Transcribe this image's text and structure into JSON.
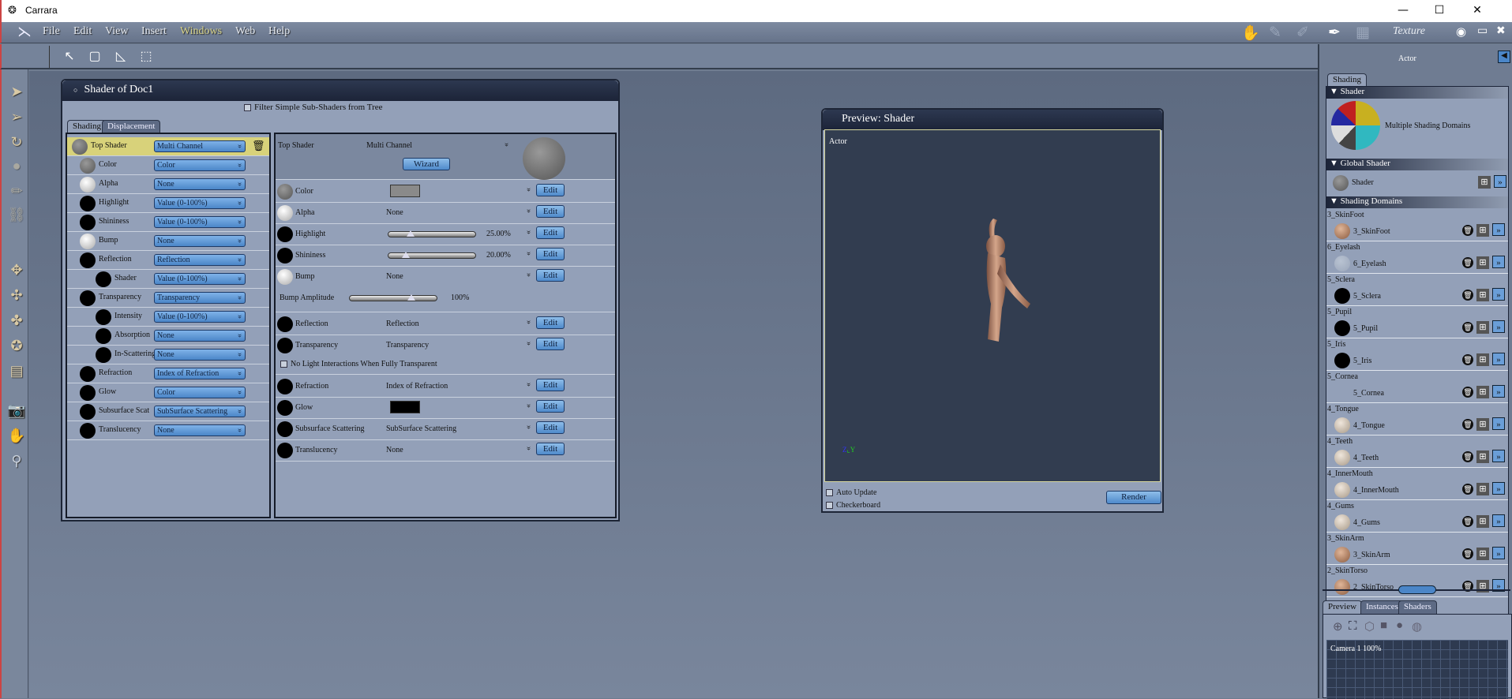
{
  "app": {
    "title": "Carrara",
    "minimize": "—",
    "maximize": "☐",
    "close": "✕"
  },
  "menu": [
    "File",
    "Edit",
    "View",
    "Insert",
    "Windows",
    "Web",
    "Help"
  ],
  "room": {
    "label": "Texture"
  },
  "shader_panel": {
    "title": "Shader of Doc1",
    "filter_label": "Filter Simple Sub-Shaders from Tree",
    "tabs": [
      "Shading",
      "Displacement"
    ],
    "tree": [
      {
        "label": "Top Shader",
        "value": "Multi Channel",
        "ball": "grey",
        "level": 0,
        "selected": true
      },
      {
        "label": "Color",
        "value": "Color",
        "ball": "grey",
        "level": 1
      },
      {
        "label": "Alpha",
        "value": "None",
        "ball": "white",
        "level": 1
      },
      {
        "label": "Highlight",
        "value": "Value (0-100%)",
        "ball": "black",
        "level": 1
      },
      {
        "label": "Shininess",
        "value": "Value (0-100%)",
        "ball": "black",
        "level": 1
      },
      {
        "label": "Bump",
        "value": "None",
        "ball": "white",
        "level": 1
      },
      {
        "label": "Reflection",
        "value": "Reflection",
        "ball": "black",
        "level": 1
      },
      {
        "label": "Shader",
        "value": "Value (0-100%)",
        "ball": "black",
        "level": 2
      },
      {
        "label": "Transparency",
        "value": "Transparency",
        "ball": "black",
        "level": 1
      },
      {
        "label": "Intensity",
        "value": "Value (0-100%)",
        "ball": "black",
        "level": 2
      },
      {
        "label": "Absorption",
        "value": "None",
        "ball": "black",
        "level": 2
      },
      {
        "label": "In-Scattering",
        "value": "None",
        "ball": "black",
        "level": 2
      },
      {
        "label": "Refraction",
        "value": "Index of Refraction",
        "ball": "black",
        "level": 1
      },
      {
        "label": "Glow",
        "value": "Color",
        "ball": "black",
        "level": 1
      },
      {
        "label": "Subsurface Scat",
        "value": "SubSurface Scattering",
        "ball": "black",
        "level": 1
      },
      {
        "label": "Translucency",
        "value": "None",
        "ball": "black",
        "level": 1
      }
    ],
    "top": {
      "label": "Top Shader",
      "value": "Multi Channel",
      "wizard": "Wizard"
    },
    "channels": [
      {
        "label": "Color",
        "value": "",
        "ball": "grey",
        "kind": "swatch",
        "swatch": "#8a8a8a"
      },
      {
        "label": "Alpha",
        "value": "None",
        "ball": "white",
        "kind": "text"
      },
      {
        "label": "Highlight",
        "value": "25.00%",
        "ball": "black",
        "kind": "slider",
        "level": 0.25
      },
      {
        "label": "Shininess",
        "value": "20.00%",
        "ball": "black",
        "kind": "slider",
        "level": 0.2
      },
      {
        "label": "Bump",
        "value": "None",
        "ball": "white",
        "kind": "text"
      },
      {
        "label": "Reflection",
        "value": "Reflection",
        "ball": "black",
        "kind": "text"
      },
      {
        "label": "Transparency",
        "value": "Transparency",
        "ball": "black",
        "kind": "text"
      },
      {
        "label": "Refraction",
        "value": "Index of Refraction",
        "ball": "black",
        "kind": "text"
      },
      {
        "label": "Glow",
        "value": "",
        "ball": "black",
        "kind": "swatch",
        "swatch": "#000000"
      },
      {
        "label": "Subsurface Scattering",
        "value": "SubSurface Scattering",
        "ball": "black",
        "kind": "text"
      },
      {
        "label": "Translucency",
        "value": "None",
        "ball": "black",
        "kind": "text"
      }
    ],
    "edit_label": "Edit",
    "bump_amplitude": {
      "label": "Bump Amplitude",
      "value": "100%",
      "level": 0.7
    },
    "no_light_label": "No Light Interactions When Fully Transparent"
  },
  "preview": {
    "title": "Preview: Shader",
    "object": "Actor",
    "auto_update": "Auto Update",
    "checkerboard": "Checkerboard",
    "render": "Render"
  },
  "sidebar": {
    "object": "Actor",
    "tab": "Shading",
    "shader_section": "Shader",
    "shader_desc": "Multiple Shading Domains",
    "global_section": "Global Shader",
    "global_shader": "Shader",
    "domains_section": "Shading Domains",
    "domains": [
      {
        "name": "3_SkinFoot",
        "ball": "skin"
      },
      {
        "name": "6_Eyelash",
        "ball": "faint"
      },
      {
        "name": "5_Sclera",
        "ball": "black"
      },
      {
        "name": "5_Pupil",
        "ball": "black"
      },
      {
        "name": "5_Iris",
        "ball": "black"
      },
      {
        "name": "5_Cornea",
        "ball": "none"
      },
      {
        "name": "4_Tongue",
        "ball": "pale"
      },
      {
        "name": "4_Teeth",
        "ball": "pale"
      },
      {
        "name": "4_InnerMouth",
        "ball": "pale"
      },
      {
        "name": "4_Gums",
        "ball": "pale"
      },
      {
        "name": "3_SkinArm",
        "ball": "skin"
      },
      {
        "name": "2_SkinTorso",
        "ball": "skin"
      }
    ],
    "bottom_tabs": [
      "Preview",
      "Instances",
      "Shaders"
    ],
    "camera_label": "Camera 1 100%"
  }
}
